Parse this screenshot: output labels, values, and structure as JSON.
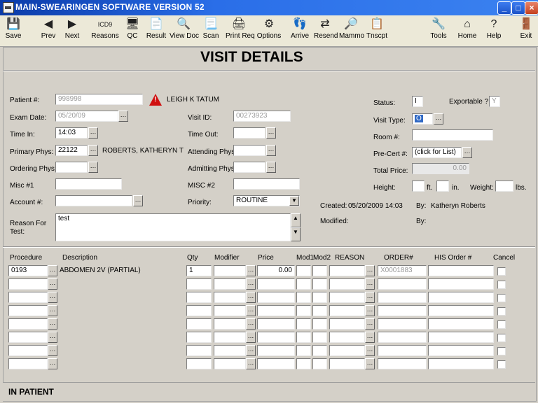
{
  "window": {
    "title": "MAIN-SWEARINGEN SOFTWARE VERSION 52"
  },
  "toolbar": [
    {
      "label": "Save",
      "icon": "floppy-icon",
      "glyph": "💾"
    },
    {
      "label": "Prev",
      "icon": "arrow-left-icon",
      "glyph": "◀"
    },
    {
      "label": "Next",
      "icon": "arrow-right-icon",
      "glyph": "▶"
    },
    {
      "label": "Reasons",
      "icon": "icd9-icon",
      "glyph": "ICD9"
    },
    {
      "label": "QC",
      "icon": "monitor-icon",
      "glyph": "🖥"
    },
    {
      "label": "Result",
      "icon": "result-icon",
      "glyph": "📄"
    },
    {
      "label": "View Doc",
      "icon": "view-doc-icon",
      "glyph": "🔍"
    },
    {
      "label": "Scan",
      "icon": "scan-icon",
      "glyph": "📃"
    },
    {
      "label": "Print Req",
      "icon": "printer-icon",
      "glyph": "🖨"
    },
    {
      "label": "Options",
      "icon": "options-icon",
      "glyph": "⚙"
    },
    {
      "label": "Arrive",
      "icon": "footprints-icon",
      "glyph": "👣"
    },
    {
      "label": "Resend",
      "icon": "resend-icon",
      "glyph": "⇄"
    },
    {
      "label": "Mammo",
      "icon": "mammo-icon",
      "glyph": "🔎"
    },
    {
      "label": "Tnscpt",
      "icon": "transcript-icon",
      "glyph": "📋"
    },
    {
      "label": "Tools",
      "icon": "tools-icon",
      "glyph": "🔧"
    },
    {
      "label": "Home",
      "icon": "home-icon",
      "glyph": "⌂"
    },
    {
      "label": "Help",
      "icon": "help-icon",
      "glyph": "?"
    },
    {
      "label": "Exit",
      "icon": "exit-icon",
      "glyph": "🚪"
    }
  ],
  "page": {
    "title": "VISIT DETAILS"
  },
  "form": {
    "patient_label": "Patient #:",
    "patient_value": "998998",
    "patient_name": "LEIGH K TATUM",
    "exam_date_label": "Exam Date:",
    "exam_date_value": "05/20/09",
    "time_in_label": "Time In:",
    "time_in_value": "14:03",
    "primary_phys_label": "Primary Phys:",
    "primary_phys_value": "22122",
    "primary_phys_name": "ROBERTS, KATHERYN T",
    "ordering_phys_label": "Ordering Phys:",
    "misc1_label": "Misc #1",
    "account_label": "Account #:",
    "reason_label_1": "Reason For",
    "reason_label_2": "Test:",
    "reason_value": "test",
    "visit_id_label": "Visit ID:",
    "visit_id_value": "00273923",
    "time_out_label": "Time Out:",
    "attending_label": "Attending Phys:",
    "admitting_label": "Admitting Phys:",
    "misc2_label": "MISC #2",
    "priority_label": "Priority:",
    "priority_value": "ROUTINE",
    "status_label": "Status:",
    "status_value": "I",
    "exportable_label": "Exportable ?",
    "exportable_value": "Y",
    "visit_type_label": "Visit Type:",
    "visit_type_value": "O",
    "room_label": "Room #:",
    "precert_label": "Pre-Cert #:",
    "precert_value": "(click for List)",
    "total_price_label": "Total Price:",
    "total_price_value": "0.00",
    "height_label": "Height:",
    "ft_label": "ft.",
    "in_label": "in.",
    "weight_label": "Weight:",
    "lbs_label": "lbs.",
    "created_label": "Created:",
    "created_value": "05/20/2009 14:03",
    "by_label": "By:",
    "by_value": "Katheryn Roberts",
    "modified_label": "Modified:",
    "modified_by_label": "By:"
  },
  "procedures": {
    "headers": {
      "procedure": "Procedure",
      "description": "Description",
      "qty": "Qty",
      "modifier": "Modifier",
      "price": "Price",
      "mod1": "Mod1",
      "mod2": "Mod2",
      "reason": "REASON",
      "order": "ORDER#",
      "his_order": "HIS Order #",
      "cancel": "Cancel"
    },
    "rows": [
      {
        "procedure": "0193",
        "description": "ABDOMEN 2V (PARTIAL)",
        "qty": "1",
        "price": "0.00",
        "order": "X0001883"
      },
      {},
      {},
      {},
      {},
      {},
      {},
      {}
    ]
  },
  "status_bar": {
    "text": "IN PATIENT"
  }
}
